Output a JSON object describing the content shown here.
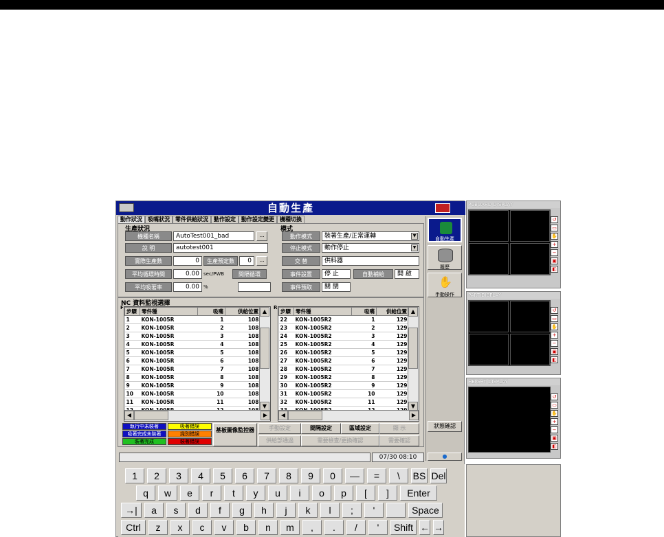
{
  "window": {
    "title": "自動生產"
  },
  "tabs": [
    "動作狀況",
    "吸嘴狀況",
    "零件供給狀況",
    "動作設定",
    "動作設定變更",
    "機種切換"
  ],
  "production": {
    "section_title": "生產狀況",
    "model_name_label": "機種名稱",
    "model_name_value": "AutoTest001_bad",
    "desc_label": "說 明",
    "desc_value": "autotest001",
    "actual_count_label": "實際生產數",
    "actual_count_value": "0",
    "planned_count_label": "生產預定數",
    "planned_count_value": "0",
    "avg_cycle_label": "平均循環時間",
    "avg_cycle_value": "0.00",
    "avg_cycle_unit": "sec/PWB",
    "interval_label": "間隔循環",
    "avg_pick_label": "平均吸著率",
    "avg_pick_value": "0.00",
    "avg_pick_unit": "%",
    "browse_btn": "..."
  },
  "mode": {
    "section_title": "模式",
    "op_mode_label": "動作模式",
    "op_mode_value": "裝著生產/正常運轉",
    "stop_mode_label": "停止模式",
    "stop_mode_value": "動作停止",
    "alt_label": "交 替",
    "alt_value": "供料器",
    "event_label": "事件設置",
    "event_value": "停 止",
    "auto_label": "自動補給",
    "auto_value": "開 啟",
    "event_pre_label": "事件預取",
    "event_pre_value": "關 閉"
  },
  "monitor": {
    "section_title": "NC 資料監視選擇",
    "left_marker": "F",
    "right_marker": "R",
    "headers": [
      "步驟",
      "零件種",
      "吸嘴",
      "供給位置"
    ],
    "left_rows": [
      [
        "1",
        "KON-1005R",
        "1",
        "108"
      ],
      [
        "2",
        "KON-1005R",
        "2",
        "108"
      ],
      [
        "3",
        "KON-1005R",
        "3",
        "108"
      ],
      [
        "4",
        "KON-1005R",
        "4",
        "108"
      ],
      [
        "5",
        "KON-1005R",
        "5",
        "108"
      ],
      [
        "6",
        "KON-1005R",
        "6",
        "108"
      ],
      [
        "7",
        "KON-1005R",
        "7",
        "108"
      ],
      [
        "8",
        "KON-1005R",
        "8",
        "108"
      ],
      [
        "9",
        "KON-1005R",
        "9",
        "108"
      ],
      [
        "10",
        "KON-1005R",
        "10",
        "108"
      ],
      [
        "11",
        "KON-1005R",
        "11",
        "108"
      ],
      [
        "12",
        "KON-1005R",
        "12",
        "108"
      ]
    ],
    "right_rows": [
      [
        "22",
        "KON-1005R2",
        "1",
        "129"
      ],
      [
        "23",
        "KON-1005R2",
        "2",
        "129"
      ],
      [
        "24",
        "KON-1005R2",
        "3",
        "129"
      ],
      [
        "25",
        "KON-1005R2",
        "4",
        "129"
      ],
      [
        "26",
        "KON-1005R2",
        "5",
        "129"
      ],
      [
        "27",
        "KON-1005R2",
        "6",
        "129"
      ],
      [
        "28",
        "KON-1005R2",
        "7",
        "129"
      ],
      [
        "29",
        "KON-1005R2",
        "8",
        "129"
      ],
      [
        "30",
        "KON-1005R2",
        "9",
        "129"
      ],
      [
        "31",
        "KON-1005R2",
        "10",
        "129"
      ],
      [
        "32",
        "KON-1005R2",
        "11",
        "129"
      ],
      [
        "33",
        "KON-1005R2",
        "12",
        "129"
      ]
    ]
  },
  "legend": {
    "items": [
      {
        "text": "執行中未裝著",
        "color": "#1010c0",
        "fg": "#ffffff"
      },
      {
        "text": "吸著錯誤",
        "color": "#ffff00",
        "fg": "#000000"
      },
      {
        "text": "吸著完成未裝著",
        "color": "#1010c0",
        "fg": "#ffffff"
      },
      {
        "text": "識別錯誤",
        "color": "#ff8000",
        "fg": "#000000"
      },
      {
        "text": "裝著完成",
        "color": "#20c020",
        "fg": "#000000"
      },
      {
        "text": "裝著錯誤",
        "color": "#e00000",
        "fg": "#000000"
      }
    ],
    "board_monitor": "基板圖像監控器"
  },
  "actions": {
    "manual_set": "手動設定",
    "interval_set": "間隔設定",
    "area_set": "區域設定",
    "display": "顯 示",
    "feeder_pass": "供給部通過",
    "cycle_check": "需要檢查/更換確認",
    "confirm": "需要確認"
  },
  "side": {
    "auto_prod": "自動生產",
    "history": "履歷",
    "manual_op": "手動操作",
    "status_confirm": "狀態確認"
  },
  "status": {
    "datetime": "07/30 08:10"
  },
  "keyboard": {
    "row1": [
      "1",
      "2",
      "3",
      "4",
      "5",
      "6",
      "7",
      "8",
      "9",
      "0",
      "—",
      "=",
      "\\",
      "BS",
      "Del"
    ],
    "row2": [
      "q",
      "w",
      "e",
      "r",
      "t",
      "y",
      "u",
      "i",
      "o",
      "p",
      "[",
      "]",
      "Enter"
    ],
    "row3": [
      "→|",
      "a",
      "s",
      "d",
      "f",
      "g",
      "h",
      "j",
      "k",
      "l",
      ";",
      "'",
      "",
      "Space"
    ],
    "row4": [
      "Ctrl",
      "z",
      "x",
      "c",
      "v",
      "b",
      "n",
      "m",
      ",",
      ".",
      "/",
      "'",
      "Shift",
      "←",
      "→"
    ]
  },
  "displays": {
    "pcboard": "PCBOARD DISPLAY",
    "part": "PART DISPLAY",
    "height": "HEIGHT DISPLAY"
  }
}
